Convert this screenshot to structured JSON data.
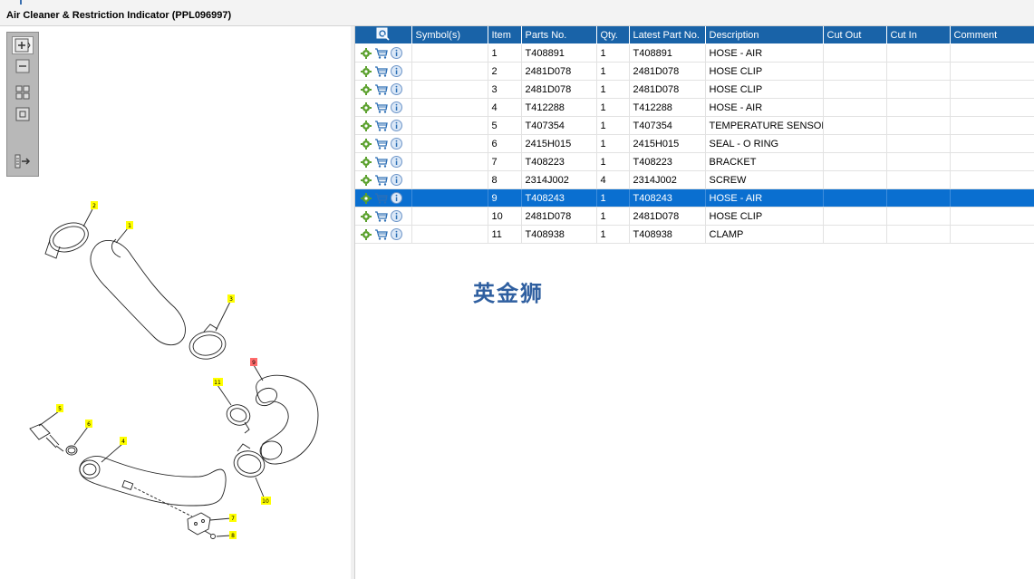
{
  "window": {
    "title": "Air Cleaner & Restriction Indicator (PPL096997)"
  },
  "toolbar": {
    "tools": [
      {
        "name": "zoom-in-icon"
      },
      {
        "name": "zoom-out-icon"
      },
      {
        "name": "fit-all-icon"
      },
      {
        "name": "actual-size-icon"
      },
      {
        "name": "export-icon"
      }
    ]
  },
  "diagram": {
    "callouts": [
      "1",
      "2",
      "3",
      "4",
      "5",
      "6",
      "7",
      "8",
      "9",
      "10",
      "11"
    ],
    "highlighted_callout": "9"
  },
  "table": {
    "columns": [
      "",
      "Symbol(s)",
      "Item",
      "Parts No.",
      "Qty.",
      "Latest Part No.",
      "Description",
      "Cut Out",
      "Cut In",
      "Comment"
    ],
    "rows": [
      {
        "symbols": "",
        "item": "1",
        "part": "T408891",
        "qty": "1",
        "latest": "T408891",
        "desc": "HOSE - AIR",
        "cut_out": "",
        "cut_in": "",
        "comment": ""
      },
      {
        "symbols": "",
        "item": "2",
        "part": "2481D078",
        "qty": "1",
        "latest": "2481D078",
        "desc": "HOSE CLIP",
        "cut_out": "",
        "cut_in": "",
        "comment": ""
      },
      {
        "symbols": "",
        "item": "3",
        "part": "2481D078",
        "qty": "1",
        "latest": "2481D078",
        "desc": "HOSE CLIP",
        "cut_out": "",
        "cut_in": "",
        "comment": ""
      },
      {
        "symbols": "",
        "item": "4",
        "part": "T412288",
        "qty": "1",
        "latest": "T412288",
        "desc": "HOSE - AIR",
        "cut_out": "",
        "cut_in": "",
        "comment": ""
      },
      {
        "symbols": "",
        "item": "5",
        "part": "T407354",
        "qty": "1",
        "latest": "T407354",
        "desc": "TEMPERATURE SENSOR",
        "cut_out": "",
        "cut_in": "",
        "comment": ""
      },
      {
        "symbols": "",
        "item": "6",
        "part": "2415H015",
        "qty": "1",
        "latest": "2415H015",
        "desc": "SEAL - O RING",
        "cut_out": "",
        "cut_in": "",
        "comment": ""
      },
      {
        "symbols": "",
        "item": "7",
        "part": "T408223",
        "qty": "1",
        "latest": "T408223",
        "desc": "BRACKET",
        "cut_out": "",
        "cut_in": "",
        "comment": ""
      },
      {
        "symbols": "",
        "item": "8",
        "part": "2314J002",
        "qty": "4",
        "latest": "2314J002",
        "desc": "SCREW",
        "cut_out": "",
        "cut_in": "",
        "comment": ""
      },
      {
        "symbols": "",
        "item": "9",
        "part": "T408243",
        "qty": "1",
        "latest": "T408243",
        "desc": "HOSE - AIR",
        "cut_out": "",
        "cut_in": "",
        "comment": ""
      },
      {
        "symbols": "",
        "item": "10",
        "part": "2481D078",
        "qty": "1",
        "latest": "2481D078",
        "desc": "HOSE CLIP",
        "cut_out": "",
        "cut_in": "",
        "comment": ""
      },
      {
        "symbols": "",
        "item": "11",
        "part": "T408938",
        "qty": "1",
        "latest": "T408938",
        "desc": "CLAMP",
        "cut_out": "",
        "cut_in": "",
        "comment": ""
      }
    ],
    "selected_item": "9",
    "row_icons": [
      "settings-icon",
      "cart-icon",
      "info-icon"
    ]
  },
  "watermark": "英金狮",
  "colors": {
    "header": "#1963a8",
    "selected_row": "#0a6fd0",
    "callout_bg": "#ffff00",
    "callout_selected": "#ff6b6b",
    "gear": "#5aa02c",
    "cart": "#2d6fb5"
  }
}
